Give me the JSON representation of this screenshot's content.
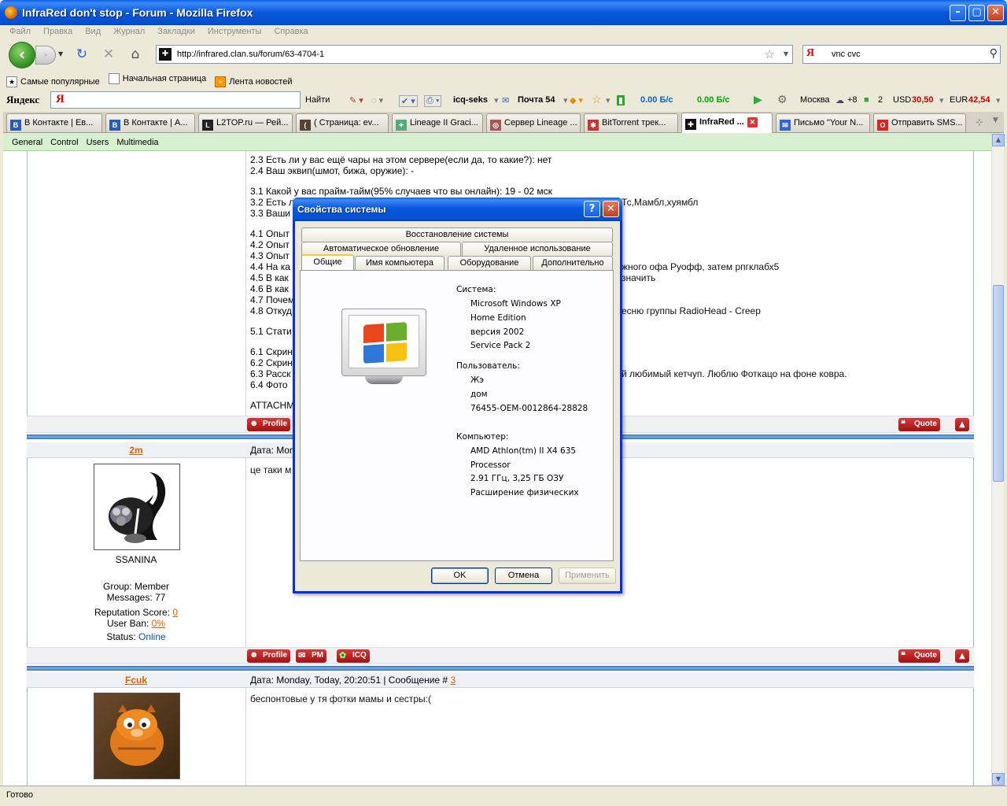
{
  "window": {
    "title": "InfraRed don't stop - Forum - Mozilla Firefox"
  },
  "menu": [
    "Файл",
    "Правка",
    "Вид",
    "Журнал",
    "Закладки",
    "Инструменты",
    "Справка"
  ],
  "address": {
    "url": "http://infrared.clan.su/forum/63-4704-1"
  },
  "search": {
    "engine": "Я",
    "value": "vnc cvc"
  },
  "bookmarks": [
    "Самые популярные",
    "Начальная страница",
    "Лента новостей"
  ],
  "yandex_bar": {
    "logo": "Яндекс",
    "input_logo": "Я",
    "find": "Найти",
    "icq": "icq-seks",
    "mail": "Почта 54",
    "speed_down": "0.00 Б/с",
    "speed_up": "0.00 Б/с",
    "city": "Москва",
    "temp": "+8",
    "count": "2",
    "usd_label": "USD",
    "usd": "30,50",
    "eur_label": "EUR",
    "eur": "42,54"
  },
  "tabs": [
    {
      "label": "В Контакте | Ев...",
      "icon": "B"
    },
    {
      "label": "В Контакте | А...",
      "icon": "B"
    },
    {
      "label": "L2TOP.ru — Рей...",
      "icon": "L"
    },
    {
      "label": "( Страница: ev...",
      "icon": "("
    },
    {
      "label": "Lineage II Graci...",
      "icon": "✦"
    },
    {
      "label": "Сервер Lineage ...",
      "icon": "◎"
    },
    {
      "label": "BitTorrent трек...",
      "icon": "✱"
    },
    {
      "label": "InfraRed ...",
      "icon": "✚",
      "active": true
    },
    {
      "label": "Письмо \"Your N...",
      "icon": "✉"
    },
    {
      "label": "Отправить SMS...",
      "icon": "O"
    }
  ],
  "forum_nav": [
    "General",
    "Control",
    "Users",
    "Multimedia"
  ],
  "post1_lines": [
    "2.3 Есть ли у вас ещё чары на этом сервере(если да, то какие?): нет",
    "2.4 Ваш эквип(шмот, бижа, оружие): -",
    "",
    "3.1 Какой у вас прайм-тайм(95% случаев что вы онлайн): 19 - 02 мск",
    "3.2 Есть л",
    "3.3 Ваши",
    "",
    "4.1 Опыт",
    "4.2 Опыт",
    "4.3 Опыт",
    "4.4 На ка",
    "4.5 В как",
    "4.6 В как",
    "4.7 Почем",
    "4.8 Откуд",
    "",
    "5.1 Стати",
    "",
    "6.1 Скрин",
    "6.2 Скрин",
    "6.3 Расск",
    "6.4 Фото",
    "",
    "ATTACHM"
  ],
  "post1_right_fragments": [
    {
      "text": "Тс,Мамбл,хуямбл"
    },
    {
      "text": "жного офа Руофф, затем рпгклабх5"
    },
    {
      "text": "значить"
    },
    {
      "text": "есню группы RadioHead - Creep"
    },
    {
      "text": "й любимый кетчуп. Люблю Фоткацо на фоне ковра."
    }
  ],
  "buttons": {
    "profile": "Profile",
    "pm": "PM",
    "icq": "ICQ",
    "quote": "Quote"
  },
  "post2": {
    "username": "2m",
    "date": "Дата: Mon",
    "text": "це таки м",
    "rank_name": "SSANINA",
    "group": "Group: Member",
    "messages": "Messages: 77",
    "reputation_label": "Reputation Score: ",
    "reputation": "0",
    "ban_label": "User Ban: ",
    "ban": "0%",
    "status_label": "Status: ",
    "status": "Online"
  },
  "post3": {
    "username": "Fcuk",
    "date": "Дата: Monday, Today, 20:20:51 | Сообщение # ",
    "msg_num": "3",
    "text": "беспонтовые у тя фотки мамы и сестры:("
  },
  "statusbar": "Готово",
  "dialog": {
    "title": "Свойства системы",
    "tabs_row1": [
      "Восстановление системы"
    ],
    "tabs_row2": [
      "Автоматическое обновление",
      "Удаленное использование"
    ],
    "tabs_row3": [
      "Общие",
      "Имя компьютера",
      "Оборудование",
      "Дополнительно"
    ],
    "system_label": "Система:",
    "system": [
      "Microsoft Windows XP",
      "Home Edition",
      "версия 2002",
      "Service Pack 2"
    ],
    "user_label": "Пользователь:",
    "user": [
      "Жэ",
      "дом",
      "76455-OEM-0012864-28828"
    ],
    "computer_label": "Компьютер:",
    "computer": [
      "AMD Athlon(tm) II X4 635",
      "Processor",
      "2.91 ГГц, 3,25 ГБ ОЗУ",
      "Расширение физических"
    ],
    "ok": "OK",
    "cancel": "Отмена",
    "apply": "Применить"
  }
}
